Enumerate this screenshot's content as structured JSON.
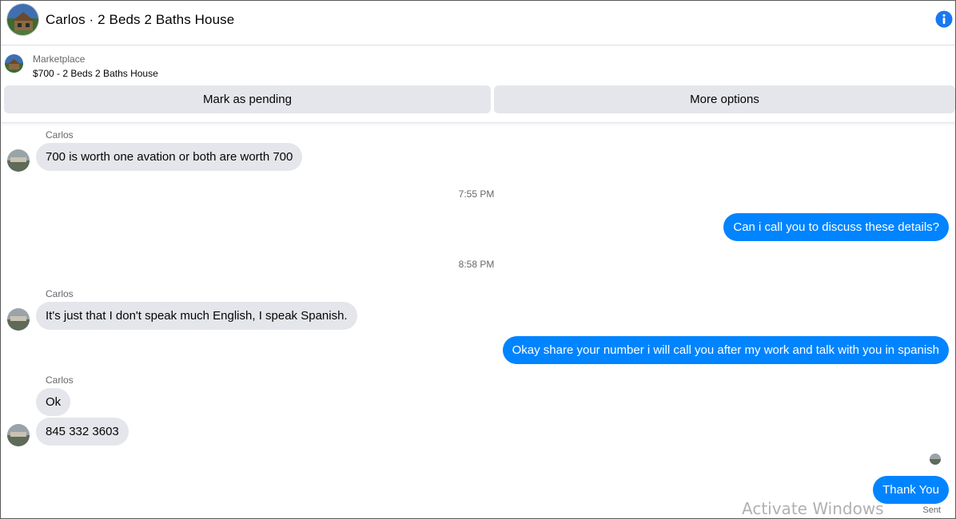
{
  "header": {
    "title": "Carlos · 2 Beds 2 Baths House",
    "info_icon": "info-icon"
  },
  "marketplace": {
    "label": "Marketplace",
    "listing": "$700 - 2 Beds 2 Baths House",
    "buttons": {
      "pending": "Mark as pending",
      "more": "More options"
    }
  },
  "messages": [
    {
      "sender": "Carlos",
      "text": "700 is worth one avation or both are worth 700"
    },
    {
      "timestamp": "7:55 PM"
    },
    {
      "outgoing": "Can i call you to discuss these details?"
    },
    {
      "timestamp": "8:58 PM"
    },
    {
      "sender": "Carlos",
      "text": "It's just that I don't speak much English, I speak Spanish."
    },
    {
      "outgoing": "Okay share your number i will call you after my work and talk with you in spanish"
    },
    {
      "sender": "Carlos",
      "text": "Ok"
    },
    {
      "text": "845 332 3603"
    },
    {
      "outgoing": "Thank You"
    }
  ],
  "status": {
    "sent": "Sent"
  },
  "watermark": "Activate Windows",
  "colors": {
    "accent": "#0084ff",
    "incoming_bubble": "#e4e6eb",
    "info": "#1877f2"
  }
}
